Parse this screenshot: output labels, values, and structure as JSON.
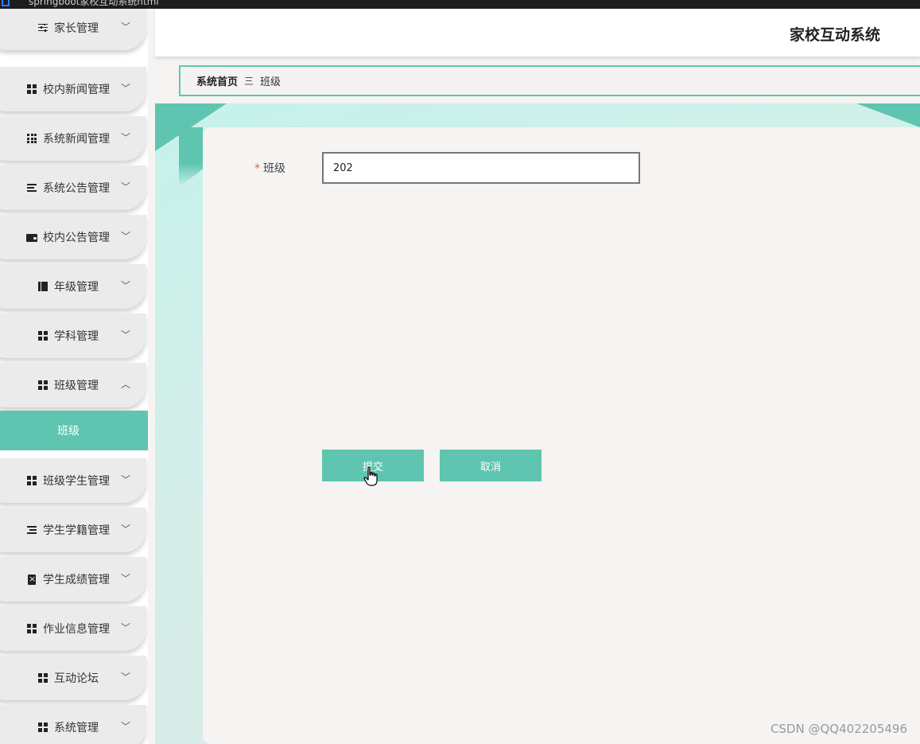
{
  "browser_tab": {
    "text": "springboot家校互动系统html"
  },
  "header": {
    "title": "家校互动系统"
  },
  "sidebar": {
    "items": [
      {
        "label": "家长管理",
        "icon": "sliders-icon"
      },
      {
        "label": "校内新闻管理",
        "icon": "grid-icon"
      },
      {
        "label": "系统新闻管理",
        "icon": "apps-icon"
      },
      {
        "label": "系统公告管理",
        "icon": "align-icon"
      },
      {
        "label": "校内公告管理",
        "icon": "wallet-icon"
      },
      {
        "label": "年级管理",
        "icon": "book-icon"
      },
      {
        "label": "学科管理",
        "icon": "grid-icon"
      },
      {
        "label": "班级管理",
        "icon": "grid-icon",
        "expanded": true
      },
      {
        "label": "班级学生管理",
        "icon": "grid-icon"
      },
      {
        "label": "学生学籍管理",
        "icon": "list-icon"
      },
      {
        "label": "学生成绩管理",
        "icon": "clipboard-icon"
      },
      {
        "label": "作业信息管理",
        "icon": "grid-icon"
      },
      {
        "label": "互动论坛",
        "icon": "grid-icon"
      },
      {
        "label": "系统管理",
        "icon": "grid-icon"
      }
    ],
    "active_subitem": "班级"
  },
  "breadcrumb": {
    "home": "系统首页",
    "separator": "三",
    "current": "班级"
  },
  "form": {
    "field_label": "班级",
    "required_mark": "*",
    "field_value": "202",
    "submit_label": "提交",
    "cancel_label": "取消"
  },
  "watermark": "CSDN @QQ402205496",
  "colors": {
    "accent": "#5fc5b0",
    "required": "#e8663d"
  }
}
